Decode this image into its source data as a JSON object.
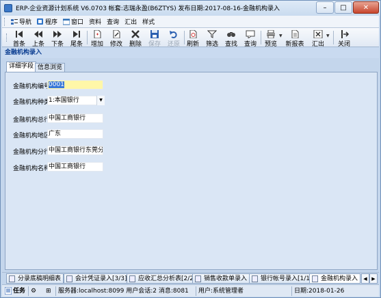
{
  "window": {
    "title": "ERP-企业资源计划系统 V6.0703 帐套:志瑞永盈(B6ZTYS) 发布日期:2017-08-16-金融机构录入"
  },
  "menubar": {
    "items": [
      {
        "label": "导航",
        "icon": "nav-icon"
      },
      {
        "label": "程序",
        "icon": "program-icon"
      },
      {
        "label": "窗口",
        "icon": "window-icon"
      },
      {
        "label": "资料"
      },
      {
        "label": "查询"
      },
      {
        "label": "汇出"
      },
      {
        "label": "样式"
      }
    ]
  },
  "toolbar": {
    "first": "首条",
    "prev": "上条",
    "next": "下条",
    "last": "尾条",
    "add": "增加",
    "edit": "修改",
    "delete": "删除",
    "save": "保存",
    "restore": "还原",
    "refresh": "刷新",
    "filter": "筛选",
    "find": "查找",
    "query": "查询",
    "preview": "预览",
    "new_report": "新报表",
    "export": "汇出",
    "close": "关闭"
  },
  "form": {
    "title": "金融机构录入",
    "tabs": [
      "详细字段",
      "信息浏览"
    ],
    "fields": [
      {
        "label": "金融机构编号",
        "value": "0001"
      },
      {
        "label": "金融机构种类",
        "value": "1:本国银行"
      },
      {
        "label": "金融机构总行",
        "value": "中国工商银行"
      },
      {
        "label": "金融机构地区",
        "value": "广东"
      },
      {
        "label": "金融机构分行",
        "value": "中国工商银行东莞分行"
      },
      {
        "label": "金融机构名称",
        "value": "中国工商银行"
      }
    ]
  },
  "window_tabs": [
    {
      "label": "分录底稿明细表"
    },
    {
      "label": "会计凭证录入[3/3]"
    },
    {
      "label": "应收汇总分析表[2/2]"
    },
    {
      "label": "销售收款单录入"
    },
    {
      "label": "银行帐号录入[1/1]"
    },
    {
      "label": "金融机构录入",
      "active": true
    }
  ],
  "statusbar": {
    "tasks": "任务",
    "server": "服务器:localhost:8099 用户会话:2 消息:8081",
    "user": "用户:系统管理者",
    "date": "日期:2018-01-26"
  },
  "colors": {
    "accent": "#0b3d91",
    "selection": "#3978d8",
    "highlight_field": "#fff7a8"
  }
}
